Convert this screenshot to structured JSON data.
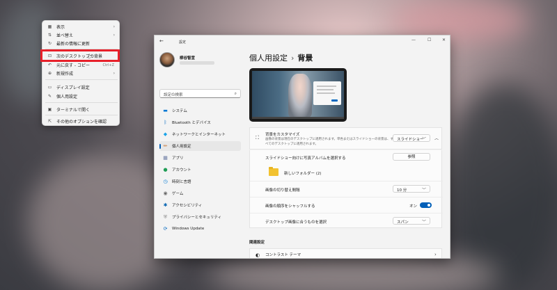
{
  "context_menu": {
    "items": [
      {
        "icon": "view-icon",
        "glyph": "▦",
        "label": "表示",
        "has_submenu": true
      },
      {
        "icon": "sort-icon",
        "glyph": "⇅",
        "label": "並べ替え",
        "has_submenu": true
      },
      {
        "icon": "refresh-icon",
        "glyph": "↻",
        "label": "最新の情報に更新",
        "has_submenu": false
      },
      {
        "icon": "next-background-icon",
        "glyph": "⊡",
        "label": "次のデスクトップの背景",
        "has_submenu": false
      },
      {
        "icon": "undo-icon",
        "glyph": "↶",
        "label": "元に戻す - コピー",
        "shortcut": "Ctrl+Z"
      },
      {
        "icon": "new-icon",
        "glyph": "⊕",
        "label": "新規作成",
        "has_submenu": true
      },
      {
        "icon": "display-icon",
        "glyph": "▭",
        "label": "ディスプレイ設定"
      },
      {
        "icon": "personalize-icon",
        "glyph": "✎",
        "label": "個人用設定"
      },
      {
        "icon": "terminal-icon",
        "glyph": "▣",
        "label": "ターミナルで開く"
      },
      {
        "icon": "more-options-icon",
        "glyph": "⇱",
        "label": "その他のオプションを確認"
      }
    ]
  },
  "window": {
    "title": "設定",
    "back_glyph": "←",
    "minimize_glyph": "—",
    "maximize_glyph": "☐",
    "close_glyph": "✕"
  },
  "profile": {
    "name": "柳谷智宣"
  },
  "search": {
    "placeholder": "設定の検索",
    "icon_glyph": "⌕"
  },
  "nav": [
    {
      "icon": "system-icon",
      "glyph": "▬",
      "color": "#0078d4",
      "label": "システム"
    },
    {
      "icon": "bluetooth-icon",
      "glyph": "ᛒ",
      "color": "#0067c0",
      "label": "Bluetooth とデバイス"
    },
    {
      "icon": "network-icon",
      "glyph": "◆",
      "color": "#1aa3e8",
      "label": "ネットワークとインターネット"
    },
    {
      "icon": "personalization-icon",
      "glyph": "✏",
      "color": "#c26d2c",
      "label": "個人用設定",
      "active": true
    },
    {
      "icon": "apps-icon",
      "glyph": "▦",
      "color": "#6b7ba3",
      "label": "アプリ"
    },
    {
      "icon": "accounts-icon",
      "glyph": "●",
      "color": "#1f9d55",
      "label": "アカウント"
    },
    {
      "icon": "time-language-icon",
      "glyph": "◷",
      "color": "#0078d4",
      "label": "時刻と言語"
    },
    {
      "icon": "gaming-icon",
      "glyph": "◉",
      "color": "#6a6a6a",
      "label": "ゲーム"
    },
    {
      "icon": "accessibility-icon",
      "glyph": "✱",
      "color": "#0b67b3",
      "label": "アクセシビリティ"
    },
    {
      "icon": "privacy-icon",
      "glyph": "⛨",
      "color": "#8a8a8a",
      "label": "プライバシーとセキュリティ"
    },
    {
      "icon": "windows-update-icon",
      "glyph": "⟳",
      "color": "#0067c0",
      "label": "Windows Update"
    }
  ],
  "main": {
    "breadcrumb_parent": "個人用設定",
    "breadcrumb_sep": "›",
    "breadcrumb_current": "背景",
    "bg_section": {
      "title": "背景をカスタマイズ",
      "desc_line1": "画像の背景は現在のデスクトップに適用されます。単色またはスライドショーの背景は、す",
      "desc_line2": "べてのデスクトップに適用されます。",
      "value": "スライドショー",
      "chevron_up": "︿",
      "chevron_down": "﹀"
    },
    "album": {
      "label": "スライドショー向けに写真アルバムを選択する",
      "button": "参照",
      "folder": "新しいフォルダー (2)"
    },
    "interval": {
      "label": "画像の切り替え間隔",
      "value": "10 分"
    },
    "shuffle": {
      "label": "画像の順序をシャッフルする",
      "state": "オン",
      "on": true
    },
    "fit": {
      "label": "デスクトップ画像に合うものを選択",
      "value": "スパン"
    },
    "related": {
      "title": "関連設定",
      "contrast": "コントラスト テーマ",
      "arrow": "›"
    }
  }
}
